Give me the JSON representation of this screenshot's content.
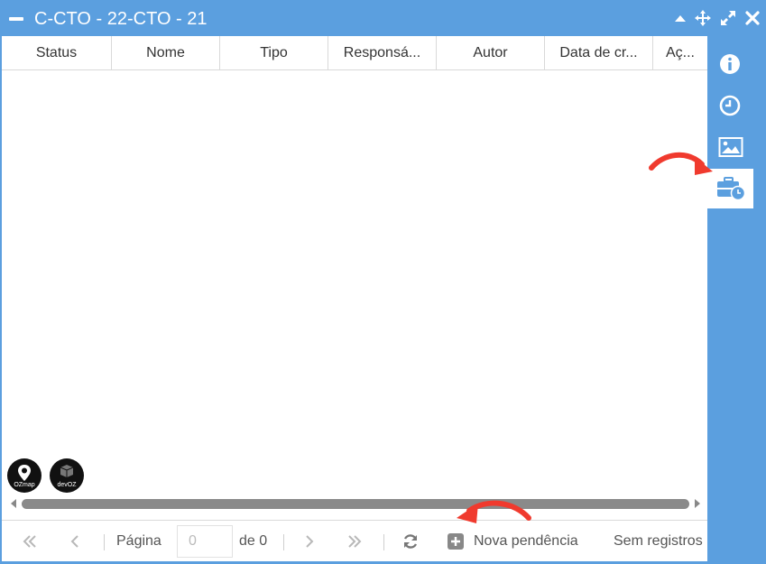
{
  "window": {
    "title": "C-CTO - 22-CTO - 21"
  },
  "columns": [
    "Status",
    "Nome",
    "Tipo",
    "Responsá...",
    "Autor",
    "Data de cr...",
    "Aç..."
  ],
  "logos": [
    {
      "text": "OZmap"
    },
    {
      "text": "devOZ"
    }
  ],
  "pager": {
    "page_label": "Página",
    "page_value": "0",
    "of_label": "de 0",
    "new_label": "Nova pendência",
    "status": "Sem registros"
  },
  "colors": {
    "accent": "#5b9fdf",
    "annotation": "#f03a2e"
  },
  "icons": [
    "minimize-icon",
    "collapse-up-icon",
    "move-icon",
    "expand-icon",
    "close-icon",
    "info-icon",
    "history-icon",
    "image-icon",
    "toolbox-clock-icon",
    "first-page-icon",
    "prev-page-icon",
    "next-page-icon",
    "last-page-icon",
    "refresh-icon",
    "plus-square-icon"
  ]
}
